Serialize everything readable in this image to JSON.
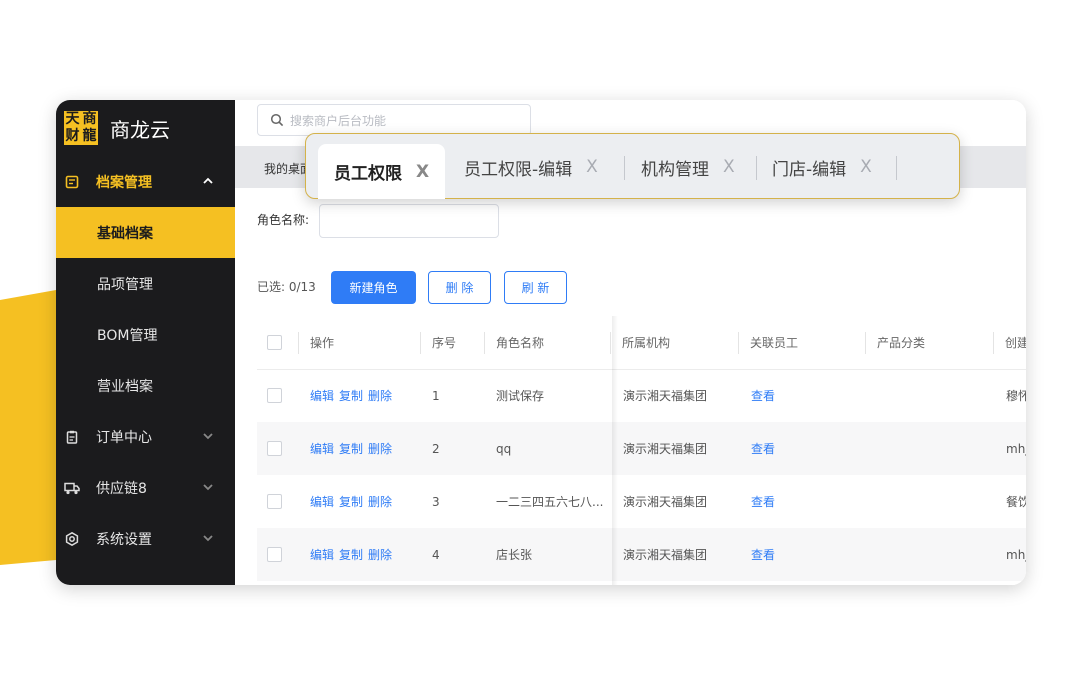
{
  "brand": {
    "logo_chars": [
      "天",
      "商",
      "财",
      "龍"
    ],
    "name": "商龙云"
  },
  "colors": {
    "accent": "#f5c022",
    "sidebar_bg": "#1b1b1d",
    "primary": "#2f7cf6"
  },
  "sidebar": {
    "items": [
      {
        "label": "档案管理",
        "icon": "archive-icon",
        "state": "expanded"
      },
      {
        "label": "基础档案",
        "state": "active"
      },
      {
        "label": "品项管理"
      },
      {
        "label": "BOM管理"
      },
      {
        "label": "营业档案"
      },
      {
        "label": "订单中心",
        "icon": "clipboard-icon"
      },
      {
        "label": "供应链8",
        "icon": "truck-icon"
      },
      {
        "label": "系统设置",
        "icon": "settings-icon"
      }
    ]
  },
  "search": {
    "placeholder": "搜索商户后台功能"
  },
  "tabs": {
    "first": "我的桌面",
    "floating": [
      {
        "label": "员工权限",
        "close": "X"
      },
      {
        "label": "员工权限-编辑",
        "close": "X"
      },
      {
        "label": "机构管理",
        "close": "X"
      },
      {
        "label": "门店-编辑",
        "close": "X"
      }
    ]
  },
  "filter": {
    "role_label": "角色名称:",
    "role_value": ""
  },
  "toolbar": {
    "selected": "已选: 0/13",
    "new_role": "新建角色",
    "delete": "删 除",
    "refresh": "刷 新"
  },
  "table": {
    "headers": [
      "操作",
      "序号",
      "角色名称",
      "所属机构",
      "关联员工",
      "产品分类",
      "创建"
    ],
    "actions": [
      "编辑",
      "复制",
      "删除"
    ],
    "rows": [
      {
        "index": "1",
        "name": "测试保存",
        "org": "演示湘天福集团",
        "staff": "查看",
        "creator": "穆怀"
      },
      {
        "index": "2",
        "name": "qq",
        "org": "演示湘天福集团",
        "staff": "查看",
        "creator": "mhj"
      },
      {
        "index": "3",
        "name": "一二三四五六七八...",
        "org": "演示湘天福集团",
        "staff": "查看",
        "creator": "餐饮"
      },
      {
        "index": "4",
        "name": "店长张",
        "org": "演示湘天福集团",
        "staff": "查看",
        "creator": "mhj"
      }
    ]
  }
}
